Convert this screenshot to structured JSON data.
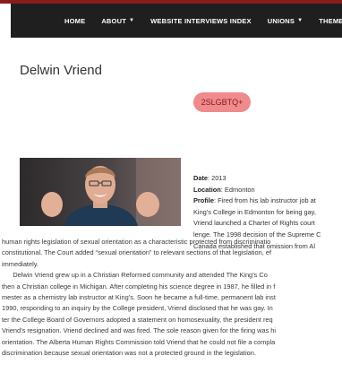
{
  "nav": {
    "items": [
      {
        "label": "HOME",
        "dropdown": false
      },
      {
        "label": "ABOUT",
        "dropdown": true
      },
      {
        "label": "WEBSITE INTERVIEWS INDEX",
        "dropdown": false
      },
      {
        "label": "UNIONS",
        "dropdown": true
      },
      {
        "label": "THEMES",
        "dropdown": false
      }
    ]
  },
  "page": {
    "title": "Delwin Vriend",
    "tag": "2SLGBTQ+"
  },
  "profile": {
    "date_label": "Date",
    "date_value": ": 2013",
    "location_label": "Location",
    "location_value": ": Edmonton",
    "profile_label": "Profile",
    "profile_lines": [
      ": Fired from his lab instructor job at",
      "King’s College in Edmonton for being gay,",
      "Vriend launched a Charter of Rights court",
      "lenge. The 1998 decision of the Supreme C",
      "Canada established that omission from Al"
    ],
    "body_lines": [
      "human rights legislation of sexual orientation as a characteristic protected from discriminatio",
      "constitutional. The Court added “sexual orientation” to relevant sections of that legislation, ef",
      "immediately.",
      "      Delwin Vriend grew up in a Christian Reformed community and attended The King’s Co",
      "then a Christian college in Michigan. After completing his science degree in 1987, he filled in f",
      "mester as a chemistry lab instructor at King’s. Soon he became a full-time, permanent lab inst",
      "1990, responding to an inquiry by the College president, Vriend disclosed that he was gay. In",
      "ter the College Board of Governors adopted a statement on homosexuality, the president req",
      "Vriend’s resignation. Vriend declined and was fired. The sole reason given for the firing was hi",
      "orientation. The Alberta Human Rights Commission told Vriend that he could not file a compla",
      "discrimination because sexual orientation was not a protected ground in the legislation."
    ]
  }
}
